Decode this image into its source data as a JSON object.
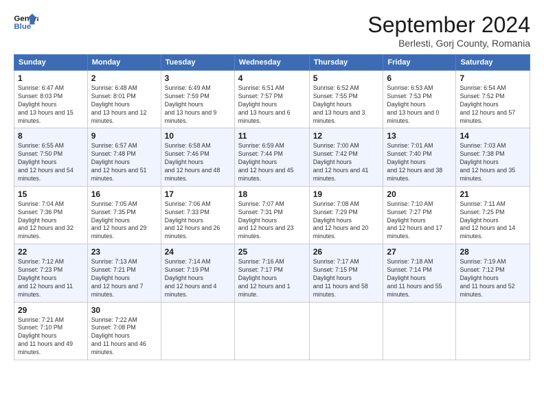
{
  "header": {
    "logo_line1": "General",
    "logo_line2": "Blue",
    "month_title": "September 2024",
    "location": "Berlesti, Gorj County, Romania"
  },
  "weekdays": [
    "Sunday",
    "Monday",
    "Tuesday",
    "Wednesday",
    "Thursday",
    "Friday",
    "Saturday"
  ],
  "weeks": [
    [
      {
        "day": "1",
        "sunrise": "6:47 AM",
        "sunset": "8:03 PM",
        "daylight": "13 hours and 15 minutes."
      },
      {
        "day": "2",
        "sunrise": "6:48 AM",
        "sunset": "8:01 PM",
        "daylight": "13 hours and 12 minutes."
      },
      {
        "day": "3",
        "sunrise": "6:49 AM",
        "sunset": "7:59 PM",
        "daylight": "13 hours and 9 minutes."
      },
      {
        "day": "4",
        "sunrise": "6:51 AM",
        "sunset": "7:57 PM",
        "daylight": "13 hours and 6 minutes."
      },
      {
        "day": "5",
        "sunrise": "6:52 AM",
        "sunset": "7:55 PM",
        "daylight": "13 hours and 3 minutes."
      },
      {
        "day": "6",
        "sunrise": "6:53 AM",
        "sunset": "7:53 PM",
        "daylight": "13 hours and 0 minutes."
      },
      {
        "day": "7",
        "sunrise": "6:54 AM",
        "sunset": "7:52 PM",
        "daylight": "12 hours and 57 minutes."
      }
    ],
    [
      {
        "day": "8",
        "sunrise": "6:55 AM",
        "sunset": "7:50 PM",
        "daylight": "12 hours and 54 minutes."
      },
      {
        "day": "9",
        "sunrise": "6:57 AM",
        "sunset": "7:48 PM",
        "daylight": "12 hours and 51 minutes."
      },
      {
        "day": "10",
        "sunrise": "6:58 AM",
        "sunset": "7:46 PM",
        "daylight": "12 hours and 48 minutes."
      },
      {
        "day": "11",
        "sunrise": "6:59 AM",
        "sunset": "7:44 PM",
        "daylight": "12 hours and 45 minutes."
      },
      {
        "day": "12",
        "sunrise": "7:00 AM",
        "sunset": "7:42 PM",
        "daylight": "12 hours and 41 minutes."
      },
      {
        "day": "13",
        "sunrise": "7:01 AM",
        "sunset": "7:40 PM",
        "daylight": "12 hours and 38 minutes."
      },
      {
        "day": "14",
        "sunrise": "7:03 AM",
        "sunset": "7:38 PM",
        "daylight": "12 hours and 35 minutes."
      }
    ],
    [
      {
        "day": "15",
        "sunrise": "7:04 AM",
        "sunset": "7:36 PM",
        "daylight": "12 hours and 32 minutes."
      },
      {
        "day": "16",
        "sunrise": "7:05 AM",
        "sunset": "7:35 PM",
        "daylight": "12 hours and 29 minutes."
      },
      {
        "day": "17",
        "sunrise": "7:06 AM",
        "sunset": "7:33 PM",
        "daylight": "12 hours and 26 minutes."
      },
      {
        "day": "18",
        "sunrise": "7:07 AM",
        "sunset": "7:31 PM",
        "daylight": "12 hours and 23 minutes."
      },
      {
        "day": "19",
        "sunrise": "7:08 AM",
        "sunset": "7:29 PM",
        "daylight": "12 hours and 20 minutes."
      },
      {
        "day": "20",
        "sunrise": "7:10 AM",
        "sunset": "7:27 PM",
        "daylight": "12 hours and 17 minutes."
      },
      {
        "day": "21",
        "sunrise": "7:11 AM",
        "sunset": "7:25 PM",
        "daylight": "12 hours and 14 minutes."
      }
    ],
    [
      {
        "day": "22",
        "sunrise": "7:12 AM",
        "sunset": "7:23 PM",
        "daylight": "12 hours and 11 minutes."
      },
      {
        "day": "23",
        "sunrise": "7:13 AM",
        "sunset": "7:21 PM",
        "daylight": "12 hours and 7 minutes."
      },
      {
        "day": "24",
        "sunrise": "7:14 AM",
        "sunset": "7:19 PM",
        "daylight": "12 hours and 4 minutes."
      },
      {
        "day": "25",
        "sunrise": "7:16 AM",
        "sunset": "7:17 PM",
        "daylight": "12 hours and 1 minute."
      },
      {
        "day": "26",
        "sunrise": "7:17 AM",
        "sunset": "7:15 PM",
        "daylight": "11 hours and 58 minutes."
      },
      {
        "day": "27",
        "sunrise": "7:18 AM",
        "sunset": "7:14 PM",
        "daylight": "11 hours and 55 minutes."
      },
      {
        "day": "28",
        "sunrise": "7:19 AM",
        "sunset": "7:12 PM",
        "daylight": "11 hours and 52 minutes."
      }
    ],
    [
      {
        "day": "29",
        "sunrise": "7:21 AM",
        "sunset": "7:10 PM",
        "daylight": "11 hours and 49 minutes."
      },
      {
        "day": "30",
        "sunrise": "7:22 AM",
        "sunset": "7:08 PM",
        "daylight": "11 hours and 46 minutes."
      },
      null,
      null,
      null,
      null,
      null
    ]
  ]
}
